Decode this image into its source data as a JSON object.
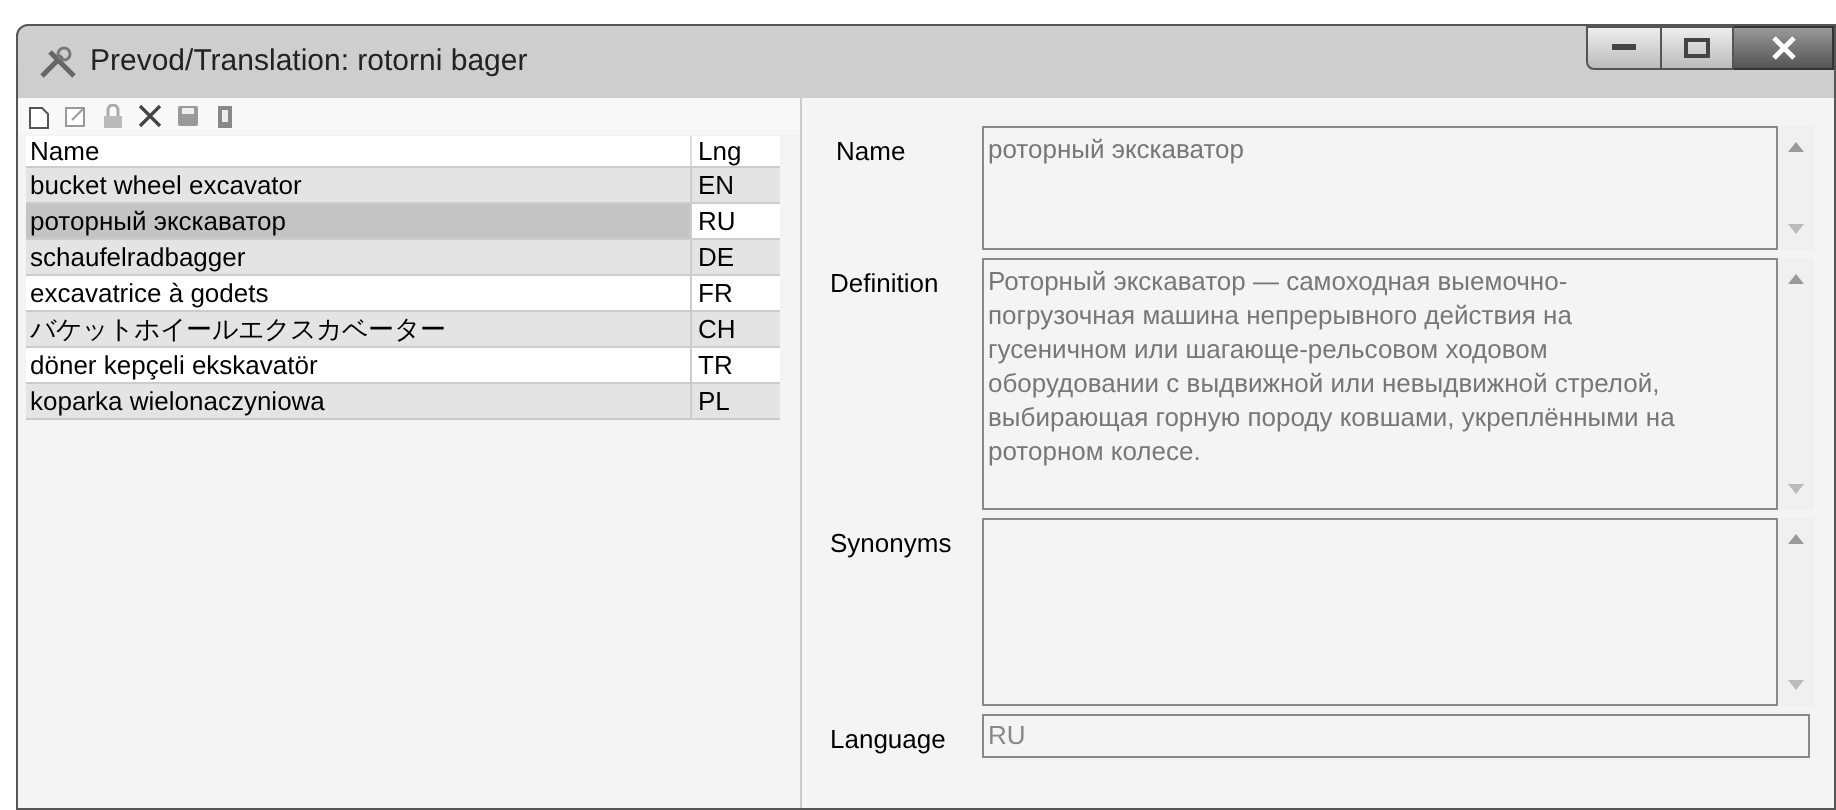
{
  "window": {
    "title": "Prevod/Translation: rotorni bager"
  },
  "table": {
    "columns": [
      "Name",
      "Lng"
    ],
    "rows": [
      {
        "name": "bucket wheel excavator",
        "lng": "EN",
        "selected": false
      },
      {
        "name": "роторный экскаватор",
        "lng": "RU",
        "selected": true
      },
      {
        "name": "schaufelradbagger",
        "lng": "DE",
        "selected": false
      },
      {
        "name": "excavatrice à godets",
        "lng": "FR",
        "selected": false
      },
      {
        "name": "バケットホイールエクスカベーター",
        "lng": "CH",
        "selected": false
      },
      {
        "name": "döner kepçeli ekskavatör",
        "lng": "TR",
        "selected": false
      },
      {
        "name": "koparka wielonaczyniowa",
        "lng": "PL",
        "selected": false
      }
    ]
  },
  "form": {
    "fields": [
      {
        "label": "Name",
        "value": "роторный экскаватор",
        "kind": "memo"
      },
      {
        "label": "Definition",
        "value": "Роторный экскаватор — самоходная выемочно-погрузочная машина непрерывного действия на гусеничном или шагающе-рельсовом ходовом оборудовании с выдвижной или невыдвижной стрелой, выбирающая горную породу ковшами, укреплёнными на роторном колесе.",
        "kind": "memo"
      },
      {
        "label": "Synonyms",
        "kind": "memo"
      },
      {
        "label": "Language",
        "value": "RU",
        "kind": "line"
      }
    ]
  }
}
